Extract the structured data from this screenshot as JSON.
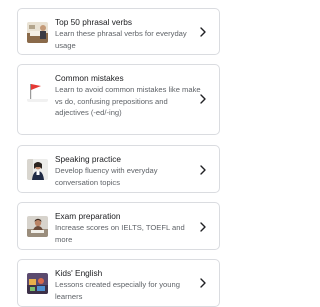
{
  "topics": [
    {
      "title": "Top 50 phrasal verbs",
      "description": "Learn these phrasal verbs for everyday usage",
      "image": "phrasal-verbs-photo"
    },
    {
      "title": "Common mistakes",
      "description": "Learn to avoid common mistakes like make vs do, confusing prepositions and adjectives (-ed/-ing)",
      "image": "red-flag-photo"
    },
    {
      "title": "Speaking practice",
      "description": "Develop fluency with everyday conversation topics",
      "image": "speaking-person-photo"
    },
    {
      "title": "Exam preparation",
      "description": "Increase scores on IELTS, TOEFL and more",
      "image": "exam-student-photo"
    },
    {
      "title": "Kids' English",
      "description": "Lessons created especially for young learners",
      "image": "kids-toys-photo"
    }
  ],
  "chevron_icon": "chevron-right-icon",
  "colors": {
    "title": "#202124",
    "description": "#5f6368",
    "border": "#dadce0"
  }
}
